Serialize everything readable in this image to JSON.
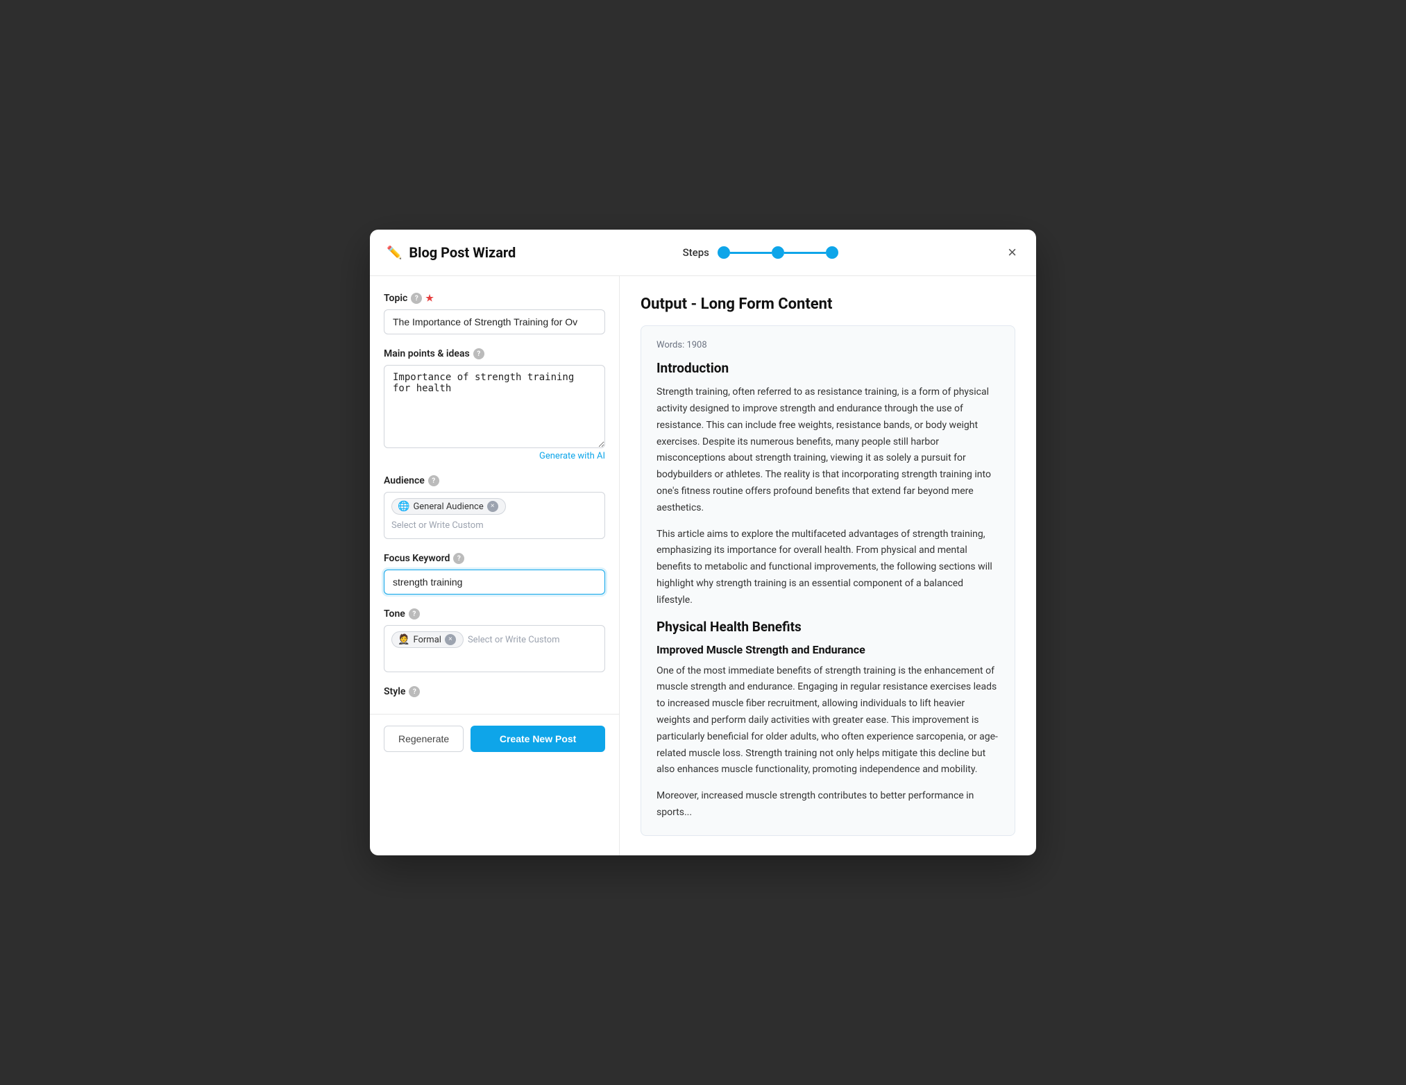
{
  "modal": {
    "title": "Blog Post Wizard",
    "close_label": "×",
    "steps_label": "Steps"
  },
  "left": {
    "topic_label": "Topic",
    "topic_value": "The Importance of Strength Training for Ov",
    "topic_placeholder": "Enter topic...",
    "main_points_label": "Main points & ideas",
    "main_points_value": "Importance of strength training for health",
    "main_points_placeholder": "Enter main points...",
    "generate_ai_label": "Generate with AI",
    "audience_label": "Audience",
    "audience_chip_icon": "🌐",
    "audience_chip_label": "General Audience",
    "audience_placeholder": "Select or Write Custom",
    "focus_keyword_label": "Focus Keyword",
    "focus_keyword_value": "strength training",
    "focus_keyword_placeholder": "Enter focus keyword...",
    "tone_label": "Tone",
    "tone_chip_icon": "🤵",
    "tone_chip_label": "Formal",
    "tone_placeholder": "Select or Write Custom",
    "style_label": "Style",
    "regenerate_label": "Regenerate",
    "create_label": "Create New Post"
  },
  "right": {
    "output_title": "Output - Long Form Content",
    "word_count": "Words: 1908",
    "sections": [
      {
        "type": "h2",
        "text": "Introduction"
      },
      {
        "type": "p",
        "text": "Strength training, often referred to as resistance training, is a form of physical activity designed to improve strength and endurance through the use of resistance. This can include free weights, resistance bands, or body weight exercises. Despite its numerous benefits, many people still harbor misconceptions about strength training, viewing it as solely a pursuit for bodybuilders or athletes. The reality is that incorporating strength training into one's fitness routine offers profound benefits that extend far beyond mere aesthetics."
      },
      {
        "type": "p",
        "text": "This article aims to explore the multifaceted advantages of strength training, emphasizing its importance for overall health. From physical and mental benefits to metabolic and functional improvements, the following sections will highlight why strength training is an essential component of a balanced lifestyle."
      },
      {
        "type": "h2",
        "text": "Physical Health Benefits"
      },
      {
        "type": "h3",
        "text": "Improved Muscle Strength and Endurance"
      },
      {
        "type": "p",
        "text": "One of the most immediate benefits of strength training is the enhancement of muscle strength and endurance. Engaging in regular resistance exercises leads to increased muscle fiber recruitment, allowing individuals to lift heavier weights and perform daily activities with greater ease. This improvement is particularly beneficial for older adults, who often experience sarcopenia, or age-related muscle loss. Strength training not only helps mitigate this decline but also enhances muscle functionality, promoting independence and mobility."
      },
      {
        "type": "p",
        "text": "Moreover, increased muscle strength contributes to better performance in sports..."
      }
    ]
  }
}
